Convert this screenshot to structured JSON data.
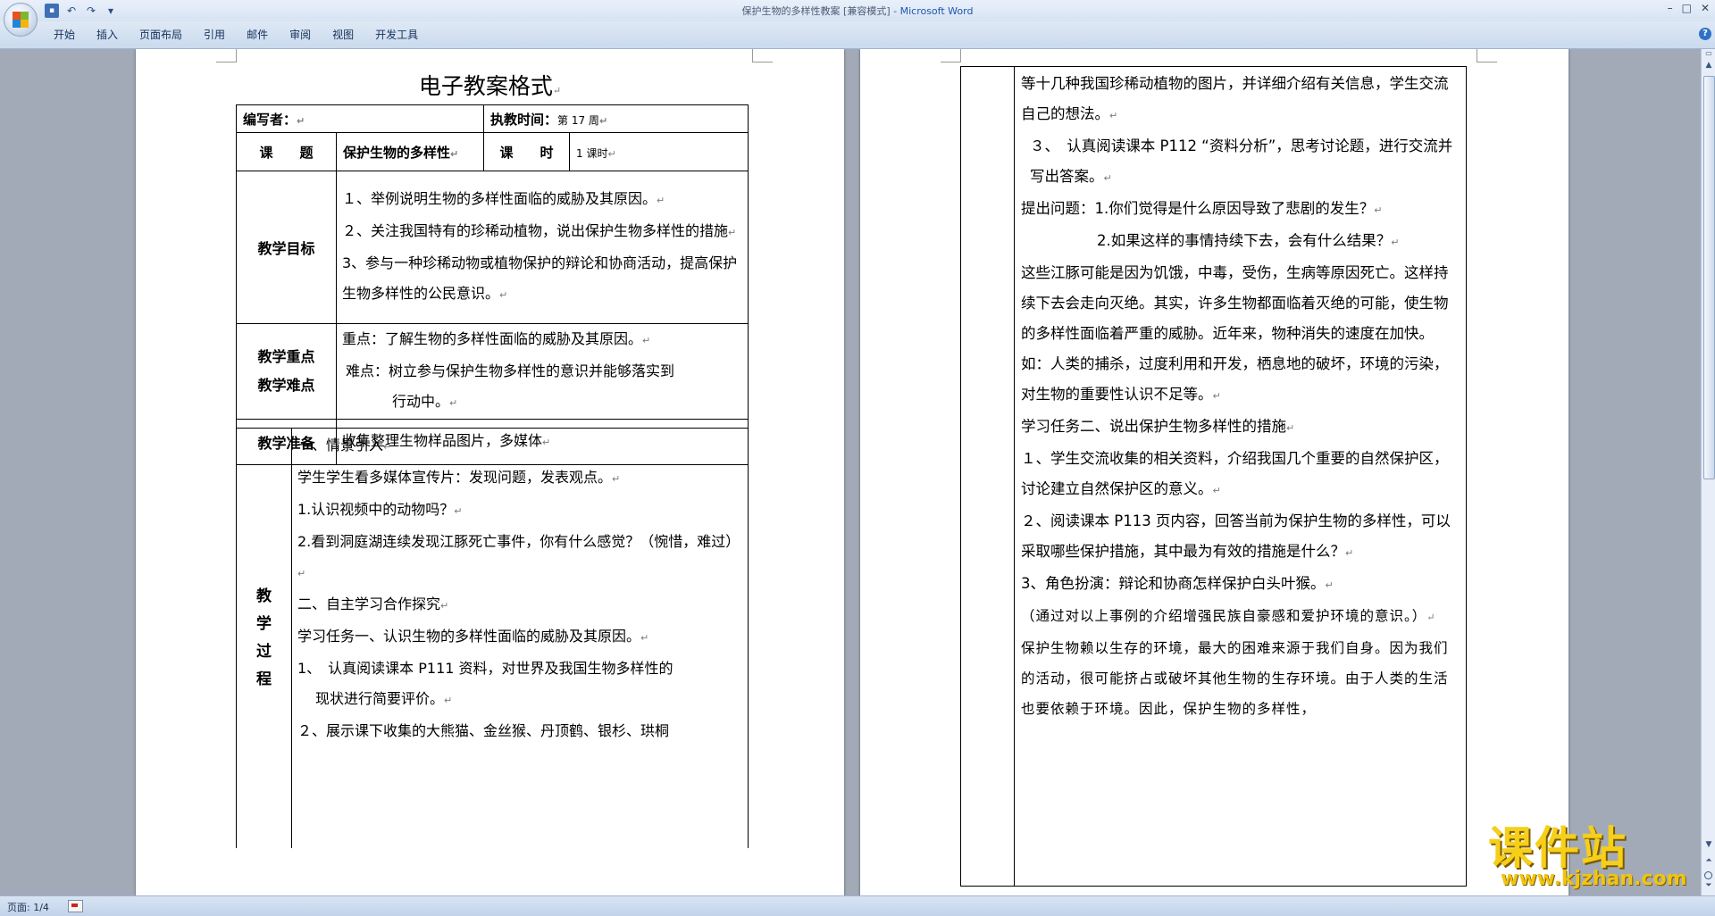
{
  "window": {
    "title": "保护生物的多样性教案 [兼容模式] - ",
    "app_name": "Microsoft Word",
    "minimize": "–",
    "maximize": "□",
    "close": "✕"
  },
  "qat": {
    "save": "▪",
    "undo": "↶",
    "redo": "↷",
    "customize": "▾"
  },
  "ribbon": {
    "tabs": [
      "开始",
      "插入",
      "页面布局",
      "引用",
      "邮件",
      "审阅",
      "视图",
      "开发工具"
    ],
    "help": "?"
  },
  "page1": {
    "doc_title": "电子教案格式",
    "author_label": "编写者：",
    "time_label": "执教时间：",
    "time_value": "第 17 周",
    "topic_label": "课　　题",
    "topic_value": "保护生物的多样性",
    "period_label": "课　　时",
    "period_value": "1 课时",
    "goals_label": "教学目标",
    "goals": [
      "１、举例说明生物的多样性面临的威胁及其原因。",
      "２、关注我国特有的珍稀动植物，说出保护生物多样性的措施",
      "3、参与一种珍稀动物或植物保护的辩论和协商活动，提高保护生物多样性的公民意识。"
    ],
    "key_label_1": "教学重点",
    "key_label_2": "教学难点",
    "key_point": "重点：了解生物的多样性面临的威胁及其原因。",
    "difficulty_1": "难点：树立参与保护生物多样性的意识并能够落实到",
    "difficulty_2": "行动中。",
    "prep_label": "教学准备",
    "prep_value": "收集整理生物样品图片，多媒体",
    "process_label": [
      "教",
      "学",
      "过",
      "程"
    ],
    "process": [
      "一、情景引入",
      "学生学生看多媒体宣传片：发现问题，发表观点。",
      "1.认识视频中的动物吗？",
      "2.看到洞庭湖连续发现江豚死亡事件，你有什么感觉？（惋惜，难过）",
      "二、自主学习合作探究",
      "学习任务一、认识生物的多样性面临的威胁及其原因。",
      "1、　认真阅读课本 P111 资料，对世界及我国生物多样性的",
      "现状进行简要评价。",
      "２、展示课下收集的大熊猫、金丝猴、丹顶鹤、银杉、珙桐"
    ]
  },
  "page2": {
    "lines": [
      "等十几种我国珍稀动植物的图片，并详细介绍有关信息，学生交流自己的想法。",
      "３、　认真阅读课本 P112 “资料分析”，思考讨论题，进行交流并写出答案。",
      "提出问题：1.你们觉得是什么原因导致了悲剧的发生？",
      "2.如果这样的事情持续下去，会有什么结果？",
      "这些江豚可能是因为饥饿，中毒，受伤，生病等原因死亡。这样持续下去会走向灭绝。其实，许多生物都面临着灭绝的可能，使生物的多样性面临着严重的威胁。近年来，物种消失的速度在加快。如：人类的捕杀，过度利用和开发，栖息地的破坏，环境的污染，对生物的重要性认识不足等。",
      "学习任务二、说出保护生物多样性的措施",
      "１、学生交流收集的相关资料，介绍我国几个重要的自然保护区，讨论建立自然保护区的意义。",
      "２、阅读课本 P113 页内容，回答当前为保护生物的多样性，可以采取哪些保护措施，其中最为有效的措施是什么？",
      "3、角色扮演：辩论和协商怎样保护白头叶猴。",
      "（通过对以上事例的介绍增强民族自豪感和爱护环境的意识。）",
      "保护生物赖以生存的环境，最大的困难来源于我们自身。因为我们的活动，很可能挤占或破坏其他生物的生存环境。由于人类的生活也要依赖于环境。因此，保护生物的多样性，"
    ]
  },
  "status": {
    "page_count": "页面: 1/4"
  },
  "watermark": {
    "main": "课件站",
    "url": "www.kjzhan.com"
  },
  "paragraph_mark": "↵"
}
